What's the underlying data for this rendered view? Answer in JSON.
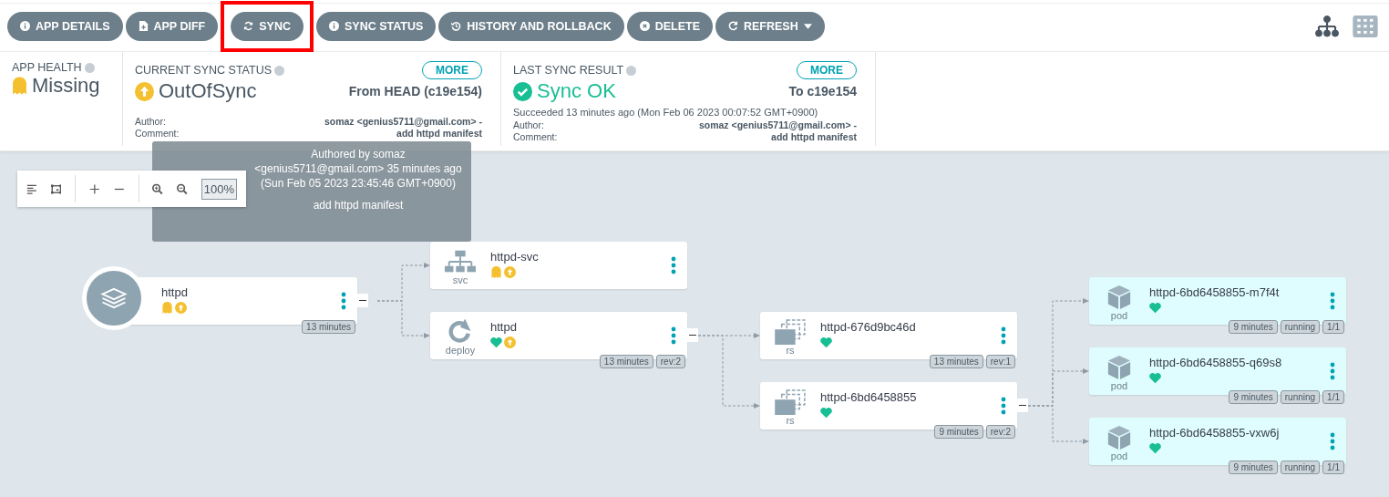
{
  "toolbar": {
    "buttons": [
      {
        "label": "APP DETAILS",
        "kind": "info",
        "highlighted": false
      },
      {
        "label": "APP DIFF",
        "kind": "file",
        "highlighted": false
      },
      {
        "label": "SYNC",
        "kind": "sync",
        "highlighted": true
      },
      {
        "label": "SYNC STATUS",
        "kind": "info",
        "highlighted": false
      },
      {
        "label": "HISTORY AND ROLLBACK",
        "kind": "history",
        "highlighted": false
      },
      {
        "label": "DELETE",
        "kind": "delete",
        "highlighted": false
      },
      {
        "label": "REFRESH",
        "kind": "refresh",
        "highlighted": false,
        "dropdown": true
      }
    ],
    "views": [
      {
        "kind": "tree",
        "selected": true
      },
      {
        "kind": "grid",
        "selected": false
      }
    ]
  },
  "app_health": {
    "label": "APP HEALTH",
    "kind": "missing",
    "value": "Missing"
  },
  "current_sync": {
    "label": "CURRENT SYNC STATUS",
    "kind": "out_of_sync",
    "value": "OutOfSync",
    "more": "MORE",
    "revision": "From HEAD (c19e154)",
    "author_label": "Author:",
    "author": "somaz <genius5711@gmail.com> -",
    "comment_label": "Comment:",
    "comment": "add httpd manifest"
  },
  "last_sync": {
    "label": "LAST SYNC RESULT",
    "kind": "synced",
    "value": "Sync OK",
    "more": "MORE",
    "revision": "To c19e154",
    "detail": "Succeeded 13 minutes ago (Mon Feb 06 2023 00:07:52 GMT+0900)",
    "author_label": "Author:",
    "author": "somaz <genius5711@gmail.com> -",
    "comment_label": "Comment:",
    "comment": "add httpd manifest"
  },
  "tooltip": {
    "lines": [
      "Authored by somaz <genius5711@gmail.com> 35 minutes ago (Sun Feb 05 2023 23:45:46 GMT+0900)",
      "add httpd manifest"
    ]
  },
  "graph_toolbar": {
    "zoom": "100%"
  },
  "graph": {
    "root": {
      "kind": "application",
      "name": "httpd",
      "status_icons": [
        {
          "kind": "missing"
        },
        {
          "kind": "out_of_sync"
        }
      ],
      "tags": [
        "13 minutes"
      ],
      "children": [
        {
          "kind": "svc",
          "type_label": "svc",
          "name": "httpd-svc",
          "status_icons": [
            {
              "kind": "missing"
            },
            {
              "kind": "out_of_sync"
            }
          ]
        },
        {
          "kind": "deploy",
          "type_label": "deploy",
          "name": "httpd",
          "status_icons": [
            {
              "kind": "healthy"
            },
            {
              "kind": "out_of_sync"
            }
          ],
          "tags": [
            "13 minutes",
            "rev:2"
          ],
          "children": [
            {
              "kind": "rs",
              "type_label": "rs",
              "name": "httpd-676d9bc46d",
              "status_icons": [
                {
                  "kind": "healthy"
                }
              ],
              "tags": [
                "13 minutes",
                "rev:1"
              ]
            },
            {
              "kind": "rs",
              "type_label": "rs",
              "name": "httpd-6bd6458855",
              "status_icons": [
                {
                  "kind": "healthy"
                }
              ],
              "tags": [
                "9 minutes",
                "rev:2"
              ],
              "children": [
                {
                  "kind": "pod",
                  "type_label": "pod",
                  "name": "httpd-6bd6458855-m7f4t",
                  "status_icons": [
                    {
                      "kind": "healthy"
                    }
                  ],
                  "tags": [
                    "9 minutes",
                    "running",
                    "1/1"
                  ]
                },
                {
                  "kind": "pod",
                  "type_label": "pod",
                  "name": "httpd-6bd6458855-q69s8",
                  "status_icons": [
                    {
                      "kind": "healthy"
                    }
                  ],
                  "tags": [
                    "9 minutes",
                    "running",
                    "1/1"
                  ]
                },
                {
                  "kind": "pod",
                  "type_label": "pod",
                  "name": "httpd-6bd6458855-vxw6j",
                  "status_icons": [
                    {
                      "kind": "healthy"
                    }
                  ],
                  "tags": [
                    "9 minutes",
                    "running",
                    "1/1"
                  ]
                }
              ]
            }
          ]
        }
      ]
    }
  }
}
